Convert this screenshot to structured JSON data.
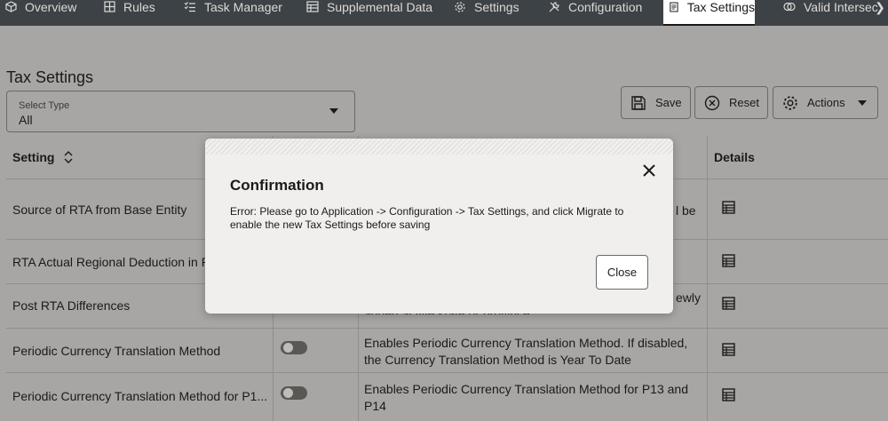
{
  "nav": {
    "tabs": [
      {
        "label": "Overview",
        "icon": "cube-icon"
      },
      {
        "label": "Rules",
        "icon": "grid-icon"
      },
      {
        "label": "Task Manager",
        "icon": "checklist-icon"
      },
      {
        "label": "Supplemental Data",
        "icon": "table-icon"
      },
      {
        "label": "Settings",
        "icon": "gear-icon"
      },
      {
        "label": "Configuration",
        "icon": "tools-icon"
      },
      {
        "label": "Tax Settings",
        "icon": "document-icon",
        "active": true
      },
      {
        "label": "Valid Intersec",
        "icon": "shapes-icon"
      }
    ],
    "next_icon": "chevron-right-icon"
  },
  "page": {
    "title": "Tax Settings",
    "select": {
      "caption": "Select Type",
      "value": "All"
    },
    "buttons": {
      "save": "Save",
      "reset": "Reset",
      "actions": "Actions"
    }
  },
  "table": {
    "headers": {
      "setting": "Setting",
      "details": "Details"
    },
    "rows": [
      {
        "setting": "Source of RTA from Base Entity",
        "description": "l be"
      },
      {
        "setting": "RTA Actual Regional Deduction in P",
        "description": ""
      },
      {
        "setting": "Post RTA Differences",
        "description": "ewly",
        "description2": "added active state or province"
      },
      {
        "setting": "Periodic Currency Translation Method",
        "description": "Enables Periodic Currency Translation Method. If disabled, the Currency Translation Method is Year To Date"
      },
      {
        "setting": "Periodic Currency Translation Method for P1...",
        "description": "Enables Periodic Currency Translation Method for P13 and P14"
      }
    ]
  },
  "modal": {
    "title": "Confirmation",
    "message": "Error: Please go to Application -> Configuration -> Tax Settings, and click Migrate to enable the new Tax Settings before saving",
    "close_label": "Close"
  },
  "colors": {
    "nav_bg": "#3d4246",
    "overlay": "#a7a6a4",
    "modal_bg": "#f1efed"
  }
}
